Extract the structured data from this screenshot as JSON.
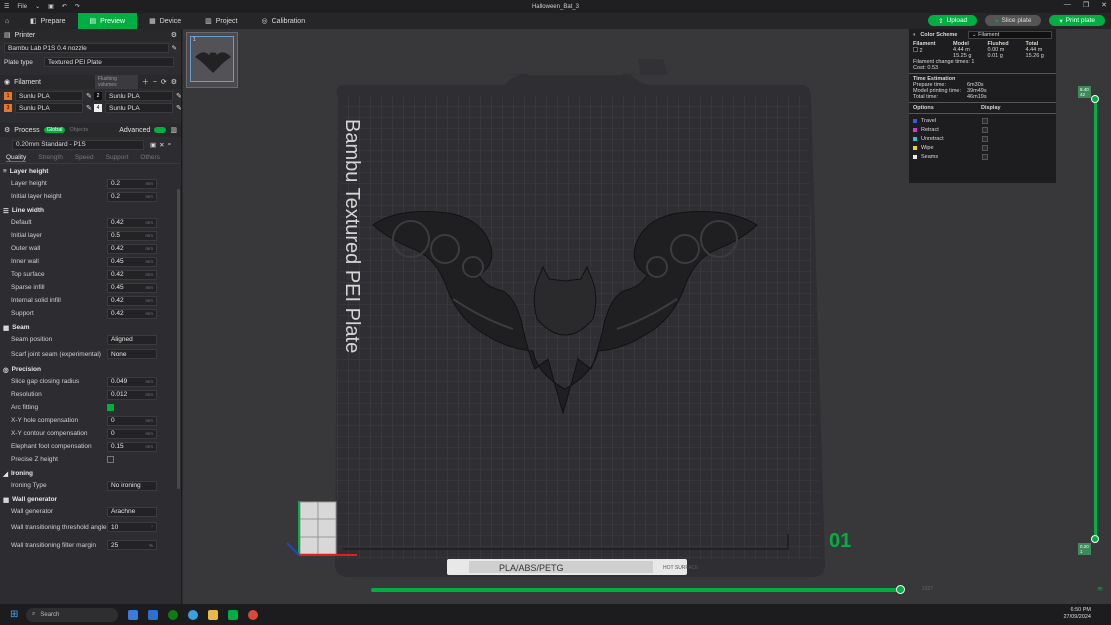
{
  "window": {
    "title": "Halloween_Bat_3",
    "menu": "File",
    "controls": [
      "—",
      "❐",
      "✕"
    ]
  },
  "toolbar": {
    "tabs": [
      {
        "label": "Prepare",
        "icon": "cube-icon"
      },
      {
        "label": "Preview",
        "icon": "preview-icon"
      },
      {
        "label": "Device",
        "icon": "device-icon"
      },
      {
        "label": "Project",
        "icon": "project-icon"
      },
      {
        "label": "Calibration",
        "icon": "calibration-icon"
      }
    ],
    "upload_label": "Upload",
    "slice_label": "Slice plate",
    "print_label": "Print plate"
  },
  "sidebar": {
    "printer_header": "Printer",
    "printer_value": "Bambu Lab P1S 0.4 nozzle",
    "plate_type_label": "Plate type",
    "plate_type_value": "Textured PEI Plate",
    "filament_header": "Filament",
    "flushing_label": "Flushing volumes",
    "filaments": [
      {
        "index": "1",
        "name": "Sunlu PLA",
        "color": "#e8762c"
      },
      {
        "index": "2",
        "name": "Sunlu PLA",
        "color": "#111111"
      },
      {
        "index": "3",
        "name": "Sunlu PLA",
        "color": "#e8762c"
      },
      {
        "index": "4",
        "name": "Sunlu PLA",
        "color": "#f0f0f0"
      }
    ],
    "process_header": "Process",
    "global_label": "Global",
    "objects_label": "Objects",
    "advanced_label": "Advanced",
    "process_preset": "0.20mm Standard - P1S",
    "tabs": [
      "Quality",
      "Strength",
      "Speed",
      "Support",
      "Others"
    ],
    "groups": {
      "layer_height": {
        "title": "Layer height",
        "rows": [
          {
            "label": "Layer height",
            "value": "0.2",
            "unit": "mm"
          },
          {
            "label": "Initial layer height",
            "value": "0.2",
            "unit": "mm"
          }
        ]
      },
      "line_width": {
        "title": "Line width",
        "rows": [
          {
            "label": "Default",
            "value": "0.42",
            "unit": "mm"
          },
          {
            "label": "Initial layer",
            "value": "0.5",
            "unit": "mm"
          },
          {
            "label": "Outer wall",
            "value": "0.42",
            "unit": "mm"
          },
          {
            "label": "Inner wall",
            "value": "0.45",
            "unit": "mm"
          },
          {
            "label": "Top surface",
            "value": "0.42",
            "unit": "mm"
          },
          {
            "label": "Sparse infill",
            "value": "0.45",
            "unit": "mm"
          },
          {
            "label": "Internal solid infill",
            "value": "0.42",
            "unit": "mm"
          },
          {
            "label": "Support",
            "value": "0.42",
            "unit": "mm"
          }
        ]
      },
      "seam": {
        "title": "Seam",
        "position_label": "Seam position",
        "position_value": "Aligned",
        "scarf_label": "Scarf joint seam (experimental)",
        "scarf_value": "None"
      },
      "precision": {
        "title": "Precision",
        "rows": [
          {
            "label": "Slice gap closing radius",
            "value": "0.049",
            "unit": "mm"
          },
          {
            "label": "Resolution",
            "value": "0.012",
            "unit": "mm"
          }
        ],
        "arc_label": "Arc fitting",
        "rows2": [
          {
            "label": "X-Y hole compensation",
            "value": "0",
            "unit": "mm"
          },
          {
            "label": "X-Y contour compensation",
            "value": "0",
            "unit": "mm"
          },
          {
            "label": "Elephant foot compensation",
            "value": "0.15",
            "unit": "mm"
          }
        ],
        "precise_z_label": "Precise Z height"
      },
      "ironing": {
        "title": "Ironing",
        "type_label": "Ironing Type",
        "type_value": "No ironing"
      },
      "wall_generator": {
        "title": "Wall generator",
        "gen_label": "Wall generator",
        "gen_value": "Arachne",
        "threshold_label": "Wall transitioning threshold angle",
        "threshold_value": "10",
        "threshold_unit": "°",
        "filter_label": "Wall transitioning filter margin",
        "filter_value": "25",
        "filter_unit": "%"
      }
    }
  },
  "plate": {
    "label": "Bambu Textured PEI Plate",
    "number": "01",
    "material_text": "PLA/ABS/PETG",
    "hot_text": "HOT SURFACE",
    "thumb_number": "1"
  },
  "legend": {
    "title": "Color Scheme",
    "scheme": "Filament",
    "headers": [
      "Filament",
      "Model",
      "Flushed",
      "Total"
    ],
    "row": {
      "filament": "2",
      "model": "4.44 m\n15.25 g",
      "flushed": "0.00 m\n0.01 g",
      "total": "4.44 m\n15.26 g"
    },
    "change_times": "Filament change times:  1",
    "cost": "Cost:  0.53",
    "time_header": "Time Estimation",
    "prepare": "Prepare time:",
    "prepare_val": "6m30s",
    "model_time": "Model printing time:",
    "model_time_val": "39m49s",
    "total": "Total time:",
    "total_val": "46m19s",
    "options_label": "Options",
    "display_label": "Display",
    "options": [
      {
        "name": "Travel",
        "color": "#3d5bd6"
      },
      {
        "name": "Retract",
        "color": "#d03bd0"
      },
      {
        "name": "Unretract",
        "color": "#3bc0d0"
      },
      {
        "name": "Wipe",
        "color": "#e8d23c"
      },
      {
        "name": "Seams",
        "color": "#eaeaea"
      }
    ]
  },
  "sliders": {
    "top_tag": "8.40\n42",
    "bottom_tag": "0.20\n1",
    "horiz_tag": "1327"
  },
  "taskbar": {
    "search_placeholder": "Search",
    "time": "6:50 PM",
    "date": "27/09/2024"
  }
}
